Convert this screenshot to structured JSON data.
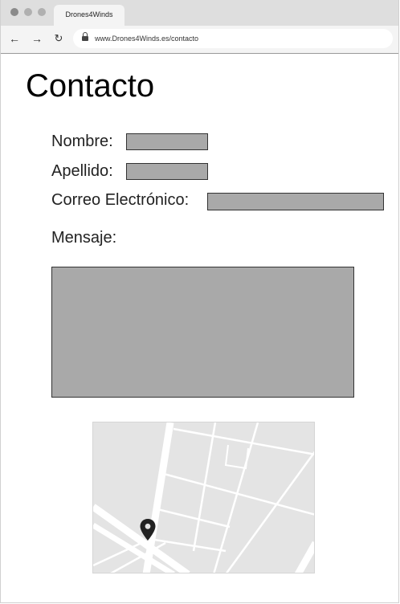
{
  "browser": {
    "tab_title": "Drones4Winds",
    "url": "www.Drones4Winds.es/contacto"
  },
  "page": {
    "title": "Contacto",
    "form": {
      "nombre_label": "Nombre:",
      "apellido_label": "Apellido:",
      "correo_label": "Correo Electrónico:",
      "mensaje_label": "Mensaje:"
    },
    "map": {
      "icon": "map-pin-icon"
    }
  },
  "colors": {
    "field_fill": "#a9a9a9",
    "map_background": "#e4e4e4"
  }
}
